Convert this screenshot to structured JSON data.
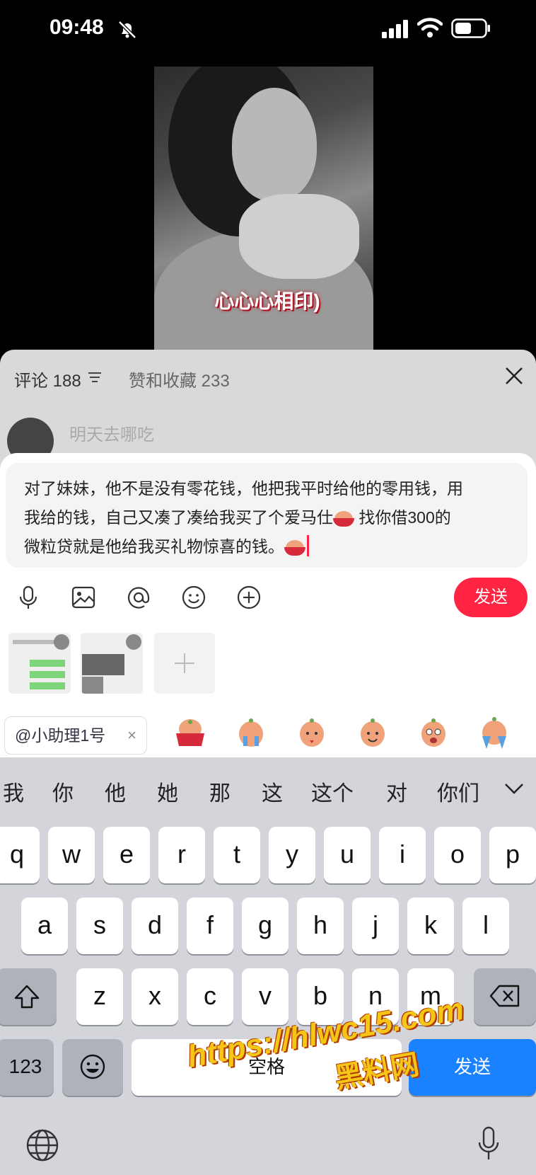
{
  "status_bar": {
    "time": "09:48"
  },
  "video": {
    "caption": "心心心相印)"
  },
  "panel": {
    "comments_tab": "评论 188",
    "likes_tab": "赞和收藏 233",
    "peek_text": "明天去哪吃"
  },
  "composer": {
    "text_line1": "对了妹妹，他不是没有零花钱，他把我平时给他的零用钱，用",
    "text_line2a": "我给的钱，自己又凑了凑给我买了个爱马仕",
    "text_line2b": "找你借300的",
    "text_line3": "微粒贷就是他给我买礼物惊喜的钱。",
    "send_label": "发送",
    "mention_chip": "@小助理1号",
    "chip_close": "×"
  },
  "keyboard": {
    "candidates": [
      "我",
      "你",
      "他",
      "她",
      "那",
      "这",
      "这个",
      "对",
      "你们"
    ],
    "row1": [
      "q",
      "w",
      "e",
      "r",
      "t",
      "y",
      "u",
      "i",
      "o",
      "p"
    ],
    "row2": [
      "a",
      "s",
      "d",
      "f",
      "g",
      "h",
      "j",
      "k",
      "l"
    ],
    "row3": [
      "z",
      "x",
      "c",
      "v",
      "b",
      "n",
      "m"
    ],
    "num_key": "123",
    "space_key": "空格",
    "send_key": "发送"
  },
  "watermark": {
    "url": "https://hlwc15.com",
    "name": "黑料网"
  },
  "colors": {
    "accent": "#ff2442",
    "keyboard_bg": "#d3d5db",
    "ios_blue": "#1a82ff"
  }
}
